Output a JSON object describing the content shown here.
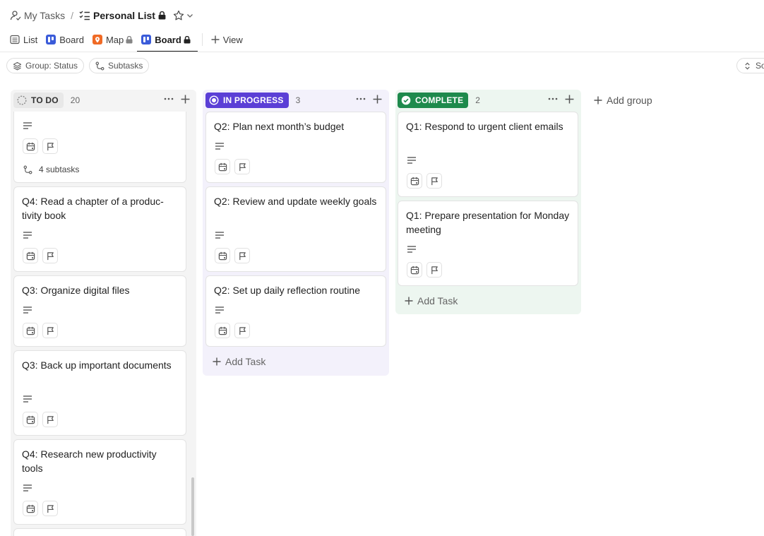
{
  "breadcrumb": {
    "parent": "My Tasks",
    "separator": "/",
    "current": "Personal List"
  },
  "views": {
    "tabs": [
      {
        "label": "List",
        "icon": "list-icon"
      },
      {
        "label": "Board",
        "icon": "board-icon"
      },
      {
        "label": "Map",
        "icon": "map-pin-icon",
        "locked": true
      },
      {
        "label": "Board",
        "icon": "board-icon",
        "locked": true,
        "active": true
      }
    ],
    "add_view_label": "View"
  },
  "toolbar": {
    "group_label": "Group: Status",
    "subtasks_label": "Subtasks",
    "sort_label": "So"
  },
  "columns": {
    "todo": {
      "label": "TO DO",
      "count": "20",
      "color": "#e8e8e8",
      "cards": [
        {
          "title": "",
          "subtasks": "4 subtasks"
        },
        {
          "title": "Q4: Read a chapter of a produc-tivity book"
        },
        {
          "title": "Q3: Organize digital files"
        },
        {
          "title": "Q3: Back up important documents"
        },
        {
          "title": "Q4: Research new productivity tools"
        }
      ]
    },
    "in_progress": {
      "label": "IN PROGRESS",
      "count": "3",
      "color": "#5b3fd6",
      "cards": [
        {
          "title": "Q2: Plan next month’s budget"
        },
        {
          "title": "Q2: Review and update weekly goals"
        },
        {
          "title": "Q2: Set up daily reflection routine"
        }
      ],
      "add_task_label": "Add Task"
    },
    "complete": {
      "label": "COMPLETE",
      "count": "2",
      "color": "#1e8a4c",
      "cards": [
        {
          "title": "Q1: Respond to urgent client emails"
        },
        {
          "title": "Q1: Prepare presentation for Monday meeting"
        }
      ],
      "add_task_label": "Add Task"
    }
  },
  "add_group_label": "Add group"
}
